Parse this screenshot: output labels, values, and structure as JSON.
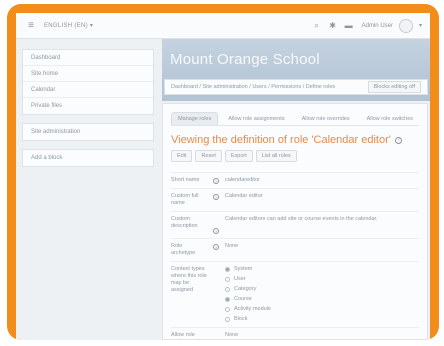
{
  "colors": {
    "frame": "#f28c1a",
    "heading": "#e78a4a",
    "banner": "#c5d3e0"
  },
  "navbar": {
    "menu_icon": "hamburger-icon",
    "language": "ENGLISH (EN) ▾",
    "icons": [
      "search-icon",
      "settings-icon",
      "message-icon"
    ],
    "user_name": "Admin User",
    "caret": "▾"
  },
  "sidebar": {
    "nav_items": [
      "Dashboard",
      "Site home",
      "Calendar",
      "Private files"
    ],
    "admin_items": [
      "Site administration"
    ],
    "add_block": "Add a block"
  },
  "header": {
    "site_title": "Mount Orange School",
    "breadcrumb": "Dashboard / Site administration / Users / Permissions / Define roles",
    "blocks_button": "Blocks editing off"
  },
  "main": {
    "tabs": [
      "Manage roles",
      "Allow role assignments",
      "Allow role overrides",
      "Allow role switches"
    ],
    "active_tab": 0,
    "heading": "Viewing the definition of role 'Calendar editor'",
    "actions": [
      "Edit",
      "Reset",
      "Export",
      "List all roles"
    ],
    "rows": {
      "short_name": {
        "label": "Short name",
        "value": "calendareditor"
      },
      "full_name": {
        "label": "Custom full name",
        "value": "Calendar editor"
      },
      "description": {
        "label": "Custom description",
        "value": "Calendar editors can add site or course events in the calendar."
      },
      "archetype": {
        "label": "Role archetype",
        "value": "None"
      },
      "context_types": {
        "label": "Context types where this role may be assigned",
        "options": [
          {
            "label": "System",
            "checked": true
          },
          {
            "label": "User",
            "checked": false
          },
          {
            "label": "Category",
            "checked": false
          },
          {
            "label": "Course",
            "checked": true
          },
          {
            "label": "Activity module",
            "checked": false
          },
          {
            "label": "Block",
            "checked": false
          }
        ]
      },
      "allow_assignments": {
        "label": "Allow role assignments",
        "value": "None"
      }
    }
  }
}
